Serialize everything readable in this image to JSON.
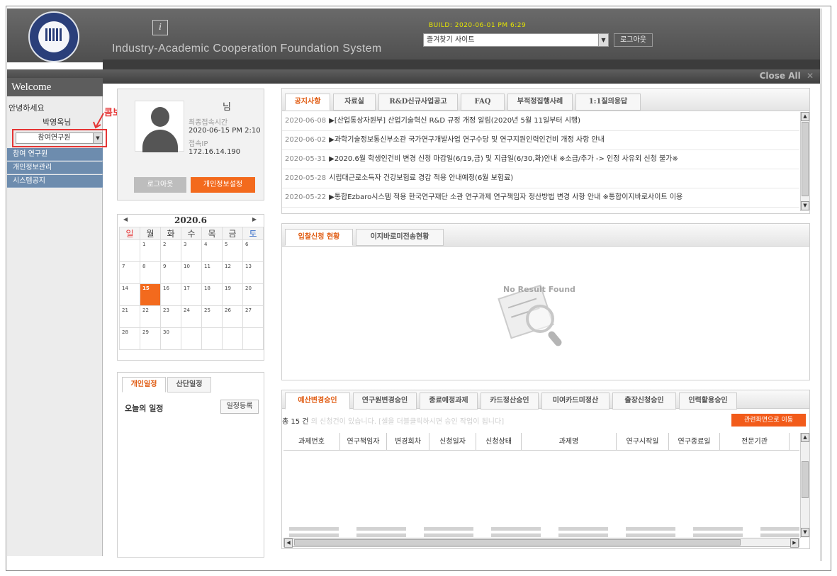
{
  "header": {
    "build": "BUILD: 2020-06-01 PM 6:29",
    "system_title": "Industry-Academic Cooperation Foundation System",
    "info_icon_glyph": "i",
    "favorites_select": "즐겨찾기 사이트",
    "logout_label": "로그아웃",
    "close_all": "Close All",
    "close_icon_glyph": "✕"
  },
  "sidebar": {
    "welcome": "Welcome",
    "greeting": "안녕하세요",
    "user": "박영옥님",
    "combo_value": "참여연구원",
    "annotation": "콤보박스 클릭",
    "items": [
      {
        "label": "참여 연구원"
      },
      {
        "label": "개인정보관리"
      },
      {
        "label": "시스템공지"
      }
    ]
  },
  "profile": {
    "suffix": "님",
    "last_login_label": "최종접속시간",
    "last_login_value": "2020-06-15 PM 2:10",
    "ip_label": "접속IP",
    "ip_value": "172.16.14.190",
    "logout_button": "로그아웃",
    "settings_button": "개인정보설정"
  },
  "calendar": {
    "month": "2020.6",
    "weekdays": [
      "일",
      "월",
      "화",
      "수",
      "목",
      "금",
      "토"
    ],
    "weeks": [
      [
        "",
        "1",
        "2",
        "3",
        "4",
        "5",
        "6"
      ],
      [
        "7",
        "8",
        "9",
        "10",
        "11",
        "12",
        "13"
      ],
      [
        "14",
        "15",
        "16",
        "17",
        "18",
        "19",
        "20"
      ],
      [
        "21",
        "22",
        "23",
        "24",
        "25",
        "26",
        "27"
      ],
      [
        "28",
        "29",
        "30",
        "",
        "",
        "",
        ""
      ]
    ],
    "today": "15"
  },
  "schedule": {
    "tabs": [
      "개인일정",
      "산단일정"
    ],
    "title": "오늘의 일정",
    "register_button": "일정등록"
  },
  "notice": {
    "tabs": [
      "공지사항",
      "자료실",
      "R&D신규사업공고",
      "FAQ",
      "부적정집행사례",
      "1:1질의응답"
    ],
    "rows": [
      {
        "date": "2020-06-08",
        "title": "▶[산업통상자원부] 산업기술혁신 R&D 규정 개정 알림(2020년 5월 11일부터 시행)"
      },
      {
        "date": "2020-06-02",
        "title": "▶과학기술정보통신부소관 국가연구개발사업 연구수당 및 연구지원인력인건비 개정 사항 안내"
      },
      {
        "date": "2020-05-31",
        "title": "▶2020.6월 학생인건비 변경 신청 마감일(6/19,금) 및 지급일(6/30,화)안내 ※소급/추가 -> 인정 사유외 신청 불가※"
      },
      {
        "date": "2020-05-28",
        "title": "시립대근로소득자 건강보험료 경감 적용 안내예정(6월 보험료)"
      },
      {
        "date": "2020-05-22",
        "title": "▶통합Ezbaro시스템 적용 한국연구재단 소관 연구과제 연구책임자 정산방법 변경 사항 안내 ※통합이지바로사이트 이용"
      }
    ]
  },
  "application": {
    "tabs": [
      "입찰신청 현황",
      "이지바로미전송현황"
    ],
    "empty_text": "No Result Found"
  },
  "approval": {
    "tabs": [
      "예산변경승인",
      "연구원변경승인",
      "종료예정과제",
      "카드정산승인",
      "미여카드미정산",
      "출장신청승인",
      "인력활용승인"
    ],
    "count_text": "총 15 건",
    "hint": "의 신청건이 있습니다. [셀을 더블클릭하시면 승인 작업이 됩니다]",
    "goto_button": "관련화면으로 이동",
    "columns": [
      "과제번호",
      "연구책임자",
      "변경회차",
      "신청일자",
      "신청상태",
      "과제명",
      "연구시작일",
      "연구종료일",
      "전문기관"
    ]
  },
  "colors": {
    "accent_orange": "#f36a1d",
    "annotation_red": "#e53535",
    "nav_blue": "#6d8cae",
    "build_yellow": "#e6e600"
  }
}
